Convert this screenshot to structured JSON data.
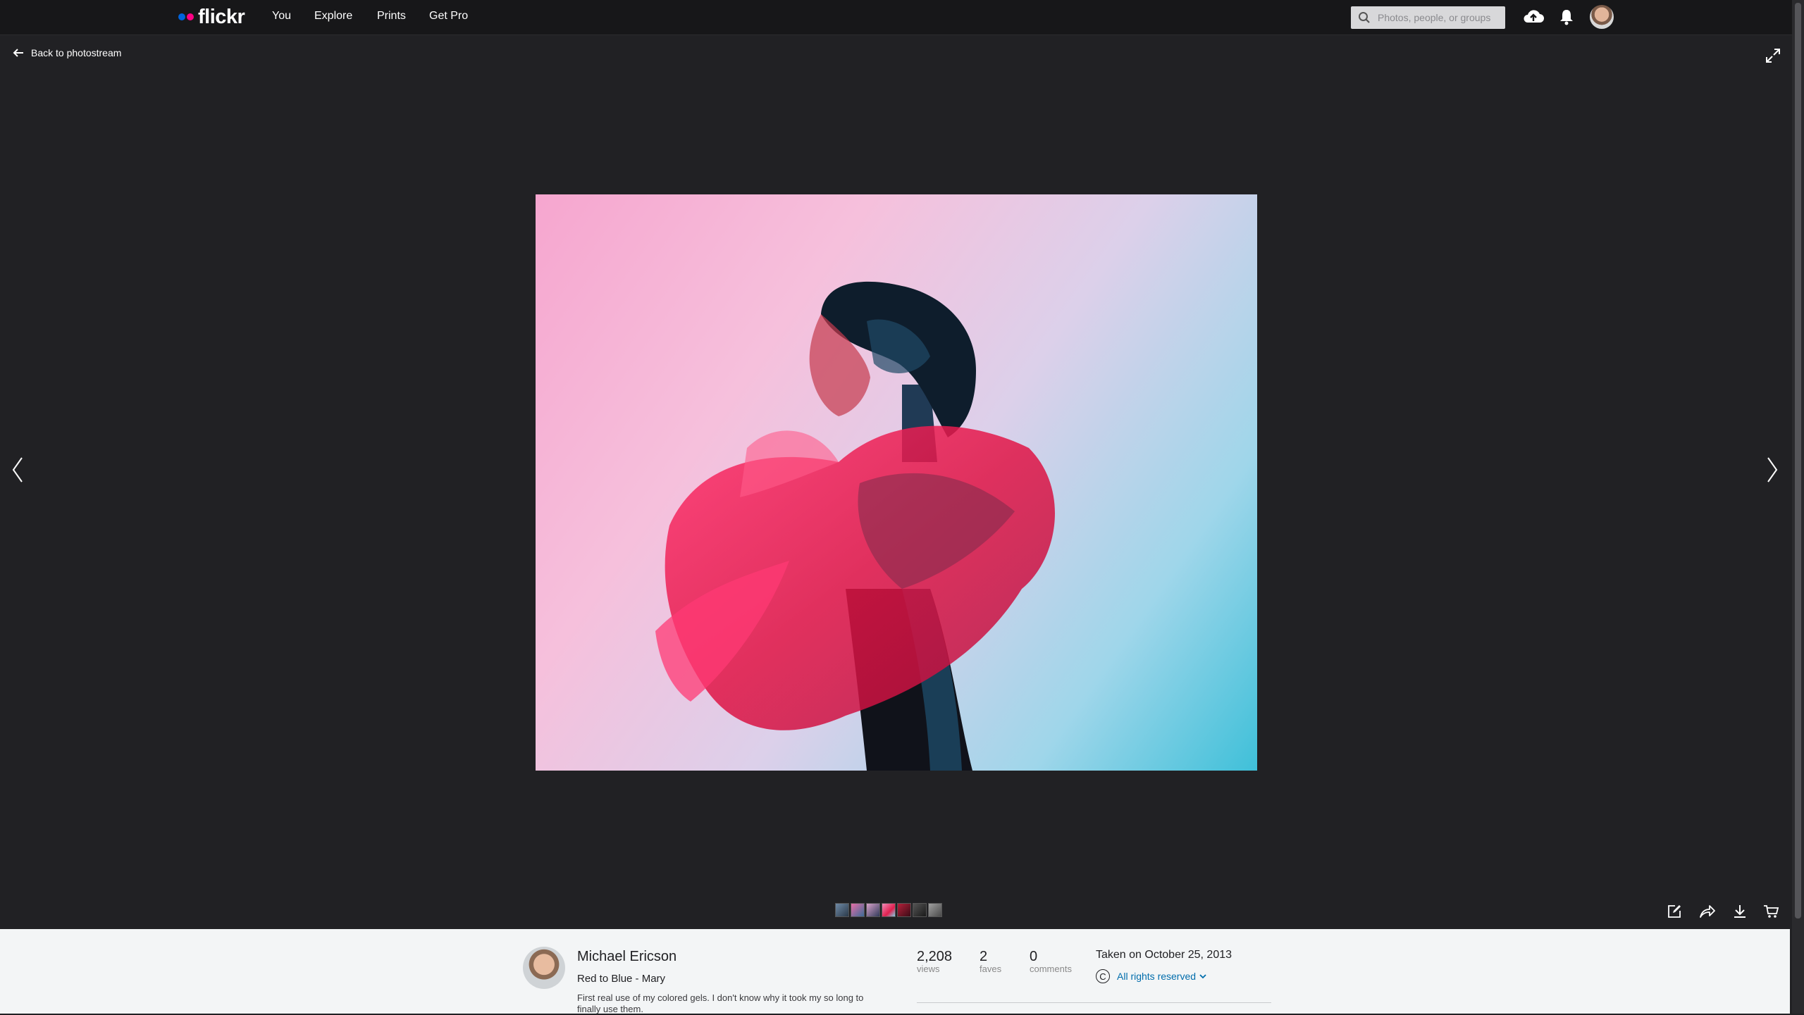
{
  "app": {
    "logo_text": "flickr",
    "colors": {
      "brand_blue": "#0063dc",
      "brand_pink": "#ff0084",
      "link_blue": "#006dac"
    }
  },
  "nav": {
    "items": [
      {
        "label": "You"
      },
      {
        "label": "Explore"
      },
      {
        "label": "Prints"
      },
      {
        "label": "Get Pro"
      }
    ]
  },
  "search": {
    "placeholder": "Photos, people, or groups"
  },
  "header_icons": [
    "search-icon",
    "upload-cloud-icon",
    "bell-icon",
    "avatar"
  ],
  "viewer": {
    "back_label": "Back to photostream",
    "icons": [
      "arrow-left-icon",
      "expand-icon",
      "chevron-left-icon",
      "chevron-right-icon"
    ],
    "filmstrip_count": 7,
    "tool_icons": [
      "edit-icon",
      "share-icon",
      "download-icon",
      "cart-icon"
    ]
  },
  "photo_info": {
    "owner": "Michael Ericson",
    "title": "Red to Blue - Mary",
    "description": "First real use of my colored gels. I don't know why it took my so long to finally use them.",
    "stats": [
      {
        "value": "2,208",
        "label": "views"
      },
      {
        "value": "2",
        "label": "faves"
      },
      {
        "value": "0",
        "label": "comments"
      }
    ],
    "taken": "Taken on October 25, 2013",
    "license": "All rights reserved"
  }
}
